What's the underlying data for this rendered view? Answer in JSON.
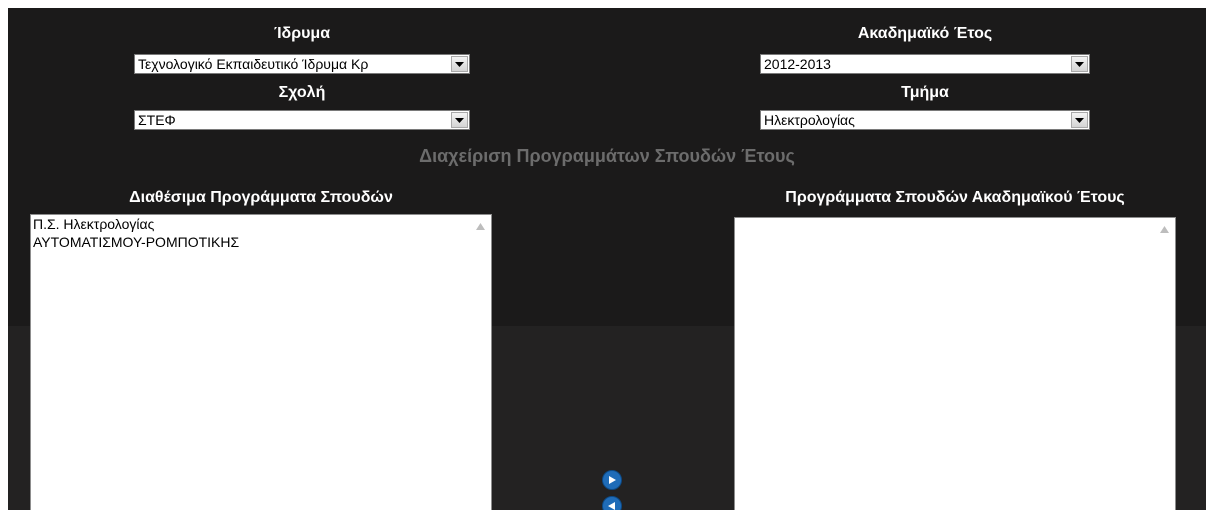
{
  "filters": {
    "institution": {
      "label": "Ίδρυμα",
      "value": "Τεχνολογικό Εκπαιδευτικό Ίδρυμα Κρ"
    },
    "academic_year": {
      "label": "Ακαδημαϊκό Έτος",
      "value": "2012-2013"
    },
    "school": {
      "label": "Σχολή",
      "value": "ΣΤΕΦ"
    },
    "department": {
      "label": "Τμήμα",
      "value": "Ηλεκτρολογίας"
    }
  },
  "heading": "Διαχείριση Προγραμμάτων Σπουδών Έτους",
  "available_programs": {
    "title": "Διαθέσιμα Προγράμματα Σπουδών",
    "items": [
      "Π.Σ. Ηλεκτρολογίας",
      "ΑΥΤΟΜΑΤΙΣΜΟΥ-ΡΟΜΠΟΤΙΚΗΣ"
    ]
  },
  "year_programs": {
    "title": "Προγράμματα Σπουδών Ακαδημαϊκού Έτους",
    "items": []
  },
  "icons": {
    "add": "arrow-right-icon",
    "remove": "arrow-left-icon"
  },
  "colors": {
    "background": "#1b1a1a",
    "heading": "#6c6c6c",
    "button": "#1f6cb8"
  }
}
